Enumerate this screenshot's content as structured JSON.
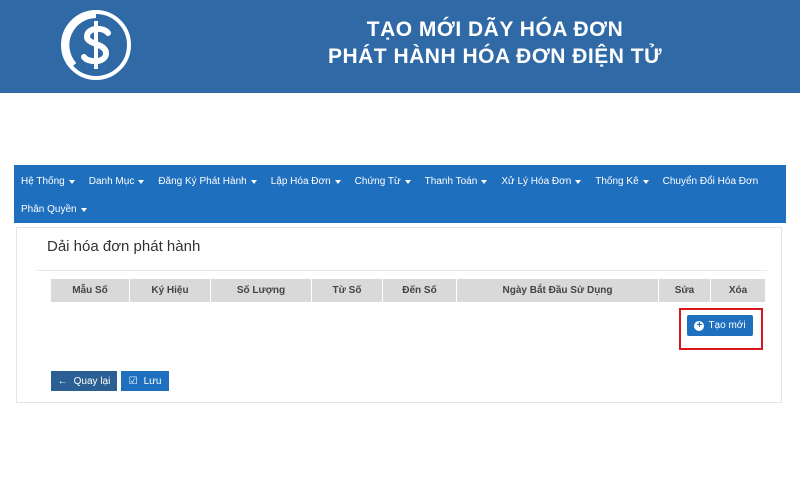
{
  "banner": {
    "title_line1": "TẠO MỚI DÃY HÓA ĐƠN",
    "title_line2": "PHÁT HÀNH HÓA ĐƠN ĐIỆN TỬ",
    "logo_icon": "dollar-logo-icon"
  },
  "nav": {
    "items": [
      {
        "label": "Hệ Thống",
        "dropdown": true
      },
      {
        "label": "Danh Mục",
        "dropdown": true
      },
      {
        "label": "Đăng Ký Phát Hành",
        "dropdown": true
      },
      {
        "label": "Lập Hóa Đơn",
        "dropdown": true
      },
      {
        "label": "Chứng Từ",
        "dropdown": true
      },
      {
        "label": "Thanh Toán",
        "dropdown": true
      },
      {
        "label": "Xử Lý Hóa Đơn",
        "dropdown": true
      },
      {
        "label": "Thống Kê",
        "dropdown": true
      },
      {
        "label": "Chuyển Đổi Hóa Đơn",
        "dropdown": false
      },
      {
        "label": "Phân Quyền",
        "dropdown": true
      }
    ]
  },
  "panel": {
    "title": "Dải hóa đơn phát hành"
  },
  "table": {
    "columns": [
      "Mẫu Số",
      "Ký Hiệu",
      "Số Lượng",
      "Từ Số",
      "Đến Số",
      "Ngày Bắt Đầu Sử Dụng",
      "Sửa",
      "Xóa"
    ]
  },
  "actions": {
    "create_label": "Tạo mới",
    "back_label": "Quay lại",
    "save_label": "Lưu"
  },
  "colors": {
    "banner": "#2f69a6",
    "navbar": "#1f6fbf",
    "highlight": "#d9161c"
  }
}
